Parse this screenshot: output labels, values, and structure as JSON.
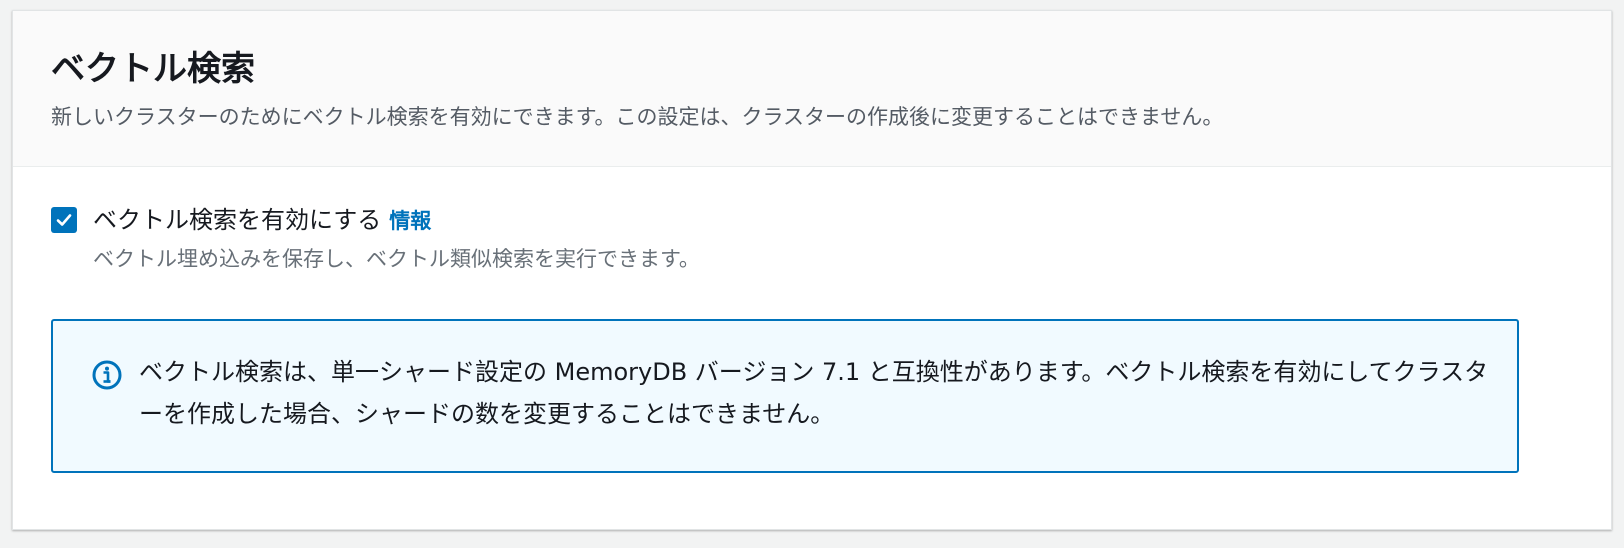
{
  "section": {
    "title": "ベクトル検索",
    "description": "新しいクラスターのためにベクトル検索を有効にできます。この設定は、クラスターの作成後に変更することはできません。"
  },
  "vector_search_option": {
    "checked": true,
    "label": "ベクトル検索を有効にする",
    "info_link": "情報",
    "description": "ベクトル埋め込みを保存し、ベクトル類似検索を実行できます。"
  },
  "info_alert": {
    "icon": "info-circle-icon",
    "text": "ベクトル検索は、単一シャード設定の MemoryDB バージョン 7.1 と互換性があります。ベクトル検索を有効にしてクラスターを作成した場合、シャードの数を変更することはできません。"
  },
  "colors": {
    "accent": "#0073bb",
    "alert_background": "#f1faff",
    "header_background": "#fafafa",
    "page_background": "#f2f3f3"
  }
}
